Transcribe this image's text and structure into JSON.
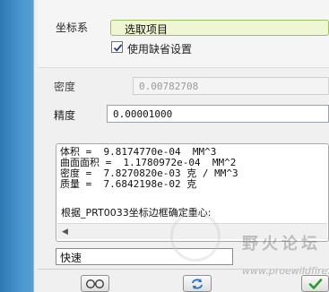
{
  "form": {
    "coordinate_label": "坐标系",
    "coordinate_value": "选取项目",
    "use_default_label": "使用缺省设置",
    "use_default_checked": true,
    "density_label": "密度",
    "density_value": "0.00782708",
    "precision_label": "精度",
    "precision_value": "0.00001000",
    "speed_value": "快速"
  },
  "output": {
    "lines": [
      "体积 =  9.8174770e-04  MM^3",
      "曲面面积 =  1.1780972e-04  MM^2",
      "密度 =  7.8270820e-03 克 / MM^3",
      "质量 =  7.6842198e-02 克"
    ],
    "note": "根据_PRT0033坐标边框确定重心:"
  },
  "watermark": {
    "text": "野火论坛",
    "url": "www.proewildfire.cn"
  },
  "colors": {
    "accent": "#3b88c3",
    "selection_bg": "#eef6d4",
    "selection_border": "#9fbf5e",
    "ok_green": "#2a9a2a"
  },
  "icons": {
    "glasses": "glasses-icon",
    "repeat": "repeat-icon",
    "ok": "checkmark-icon"
  }
}
